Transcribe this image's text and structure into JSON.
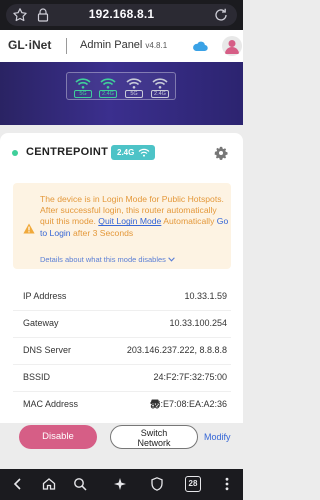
{
  "browser": {
    "url": "192.168.8.1",
    "tab_count": "28"
  },
  "header": {
    "logo": "GL·iNet",
    "title": "Admin Panel",
    "version": "v4.8.1"
  },
  "banner": {
    "signals": [
      {
        "label": "5G",
        "color": "#3fcf9a"
      },
      {
        "label": "2.4G",
        "color": "#3fcf9a"
      },
      {
        "label": "5G",
        "color": "#9aa0b8"
      },
      {
        "label": "2.4G",
        "color": "#9aa0b8"
      }
    ]
  },
  "network": {
    "name": "CENTREPOINT",
    "band": "2.4G",
    "status_color": "#3fcf9a"
  },
  "notice": {
    "text_before": "The device is in Login Mode for Public Hotspots. After successful login, this router automatically quit this mode.",
    "quit_link": "Quit Login Mode",
    "text_middle": "Automatically",
    "goto_link": "Go to Login",
    "text_after": "after 3 Seconds",
    "details": "Details about what this mode disables"
  },
  "info": {
    "rows": [
      {
        "key": "IP Address",
        "value": "10.33.1.59"
      },
      {
        "key": "Gateway",
        "value": "10.33.100.254"
      },
      {
        "key": "DNS Server",
        "value": "203.146.237.222, 8.8.8.8"
      },
      {
        "key": "BSSID",
        "value": "24:F2:7F:32:75:00"
      },
      {
        "key": "MAC Address",
        "value": "56:E7:08:EA:A2:36"
      }
    ]
  },
  "actions": {
    "disable": "Disable",
    "switch_line1": "Switch",
    "switch_line2": "Network",
    "modify": "Modify"
  },
  "colors": {
    "accent": "#d65e86",
    "badge": "#4dc3c7",
    "link": "#3566d6",
    "warning_text": "#e4983a"
  }
}
